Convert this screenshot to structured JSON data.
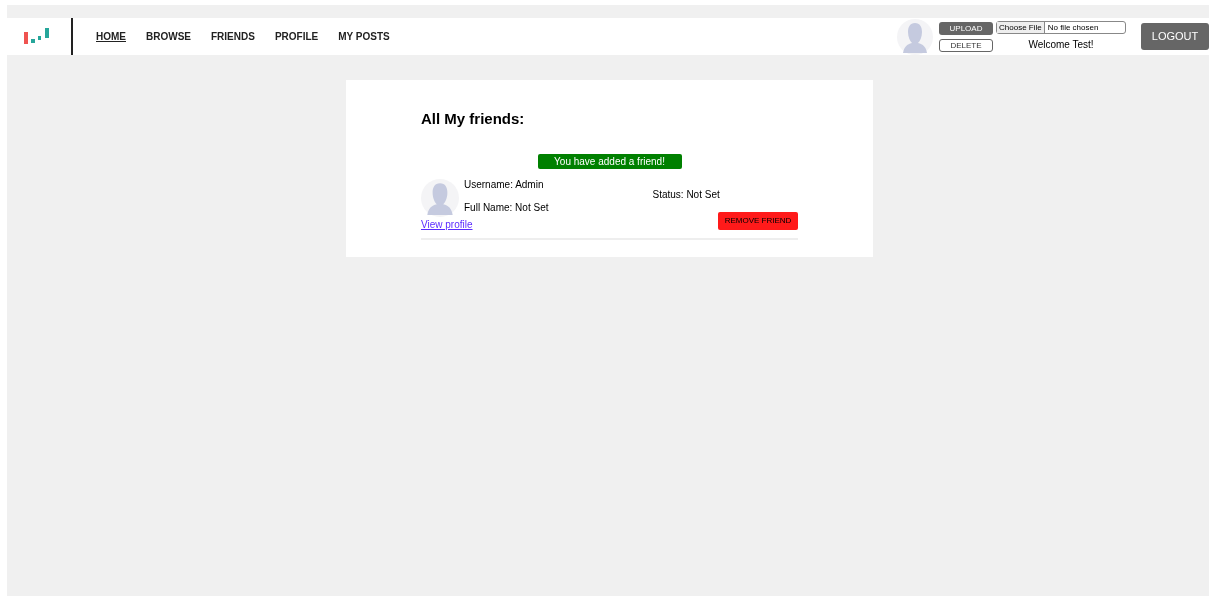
{
  "nav": [
    {
      "label": "HOME",
      "selected": true
    },
    {
      "label": "BROWSE",
      "selected": false
    },
    {
      "label": "FRIENDS",
      "selected": false
    },
    {
      "label": "PROFILE",
      "selected": false
    },
    {
      "label": "MY POSTS",
      "selected": false
    }
  ],
  "account": {
    "upload": "UPLOAD",
    "delete": "DELETE",
    "file_button": "Choose File",
    "file_status": "No file chosen",
    "welcome": "Welcome Test!",
    "logout": "LOGOUT"
  },
  "heading": "All My friends:",
  "notice": "You have added a friend!",
  "friends": [
    {
      "username": "Username: Admin",
      "full_name": "Full Name: Not Set",
      "status": "Status: Not Set",
      "link": "View profile",
      "action": "REMOVE FRIEND"
    }
  ]
}
